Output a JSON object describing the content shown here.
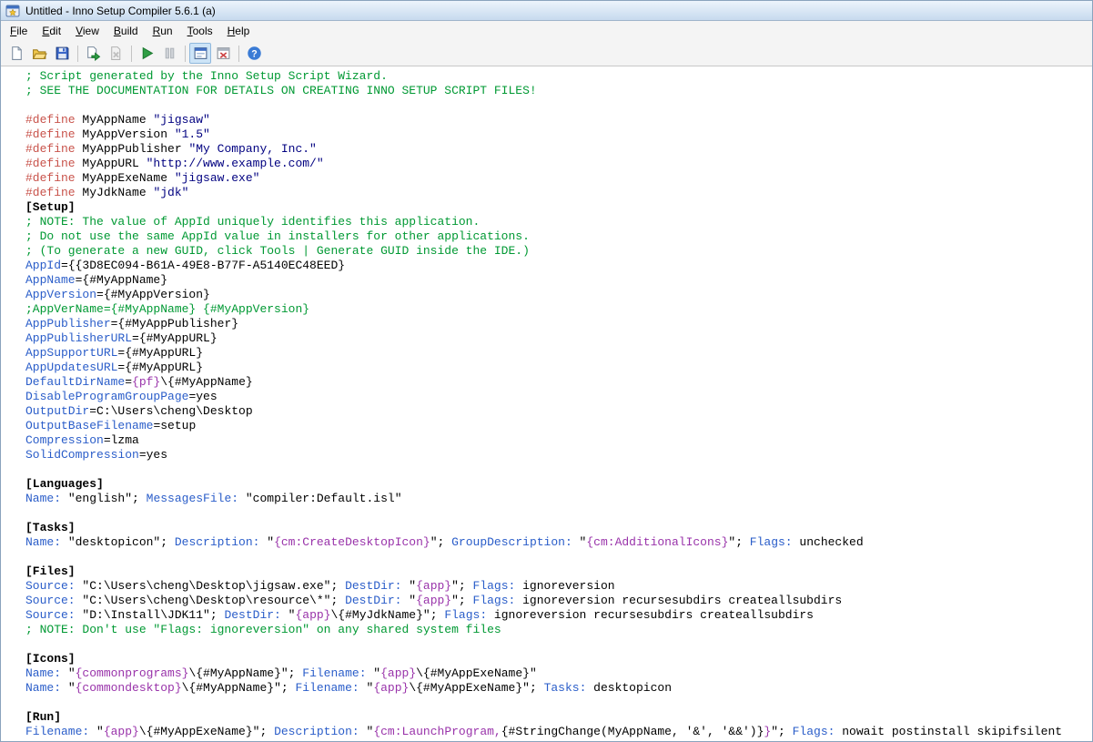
{
  "window": {
    "title": "Untitled - Inno Setup Compiler 5.6.1 (a)"
  },
  "menu": {
    "items": [
      "File",
      "Edit",
      "View",
      "Build",
      "Run",
      "Tools",
      "Help"
    ]
  },
  "toolbar": {
    "buttons": [
      {
        "name": "new-script",
        "icon": "new-script",
        "enabled": true
      },
      {
        "name": "open-script",
        "icon": "open-script",
        "enabled": true
      },
      {
        "name": "save-script",
        "icon": "save-script",
        "enabled": true
      },
      {
        "type": "separator"
      },
      {
        "name": "compile",
        "icon": "compile",
        "enabled": true
      },
      {
        "name": "stop-compile",
        "icon": "stop-compile",
        "enabled": false
      },
      {
        "type": "separator"
      },
      {
        "name": "run",
        "icon": "run",
        "enabled": true
      },
      {
        "name": "pause",
        "icon": "pause",
        "enabled": false
      },
      {
        "type": "separator"
      },
      {
        "name": "target-setup",
        "icon": "target-setup",
        "enabled": true,
        "pressed": true
      },
      {
        "name": "target-uninstall",
        "icon": "target-uninstall",
        "enabled": true
      },
      {
        "type": "separator"
      },
      {
        "name": "help",
        "icon": "help",
        "enabled": true
      }
    ]
  },
  "editor": {
    "syntax_colors": {
      "comment": "#009933",
      "define": "#C8524A",
      "keyword": "#2A5DC9",
      "constant": "#9933AA",
      "string": "#000080",
      "section": "#000000",
      "text": "#000000"
    },
    "lines": [
      [
        [
          "c",
          "; Script generated by the Inno Setup Script Wizard."
        ]
      ],
      [
        [
          "c",
          "; SEE THE DOCUMENTATION FOR DETAILS ON CREATING INNO SETUP SCRIPT FILES!"
        ]
      ],
      [],
      [
        [
          "d",
          "#define"
        ],
        [
          "t",
          " MyAppName "
        ],
        [
          "s",
          "\"jigsaw\""
        ]
      ],
      [
        [
          "d",
          "#define"
        ],
        [
          "t",
          " MyAppVersion "
        ],
        [
          "s",
          "\"1.5\""
        ]
      ],
      [
        [
          "d",
          "#define"
        ],
        [
          "t",
          " MyAppPublisher "
        ],
        [
          "s",
          "\"My Company, Inc.\""
        ]
      ],
      [
        [
          "d",
          "#define"
        ],
        [
          "t",
          " MyAppURL "
        ],
        [
          "s",
          "\"http://www.example.com/\""
        ]
      ],
      [
        [
          "d",
          "#define"
        ],
        [
          "t",
          " MyAppExeName "
        ],
        [
          "s",
          "\"jigsaw.exe\""
        ]
      ],
      [
        [
          "d",
          "#define"
        ],
        [
          "t",
          " MyJdkName "
        ],
        [
          "s",
          "\"jdk\""
        ]
      ],
      [
        [
          "b",
          "[Setup]"
        ]
      ],
      [
        [
          "c",
          "; NOTE: The value of AppId uniquely identifies this application."
        ]
      ],
      [
        [
          "c",
          "; Do not use the same AppId value in installers for other applications."
        ]
      ],
      [
        [
          "c",
          "; (To generate a new GUID, click Tools | Generate GUID inside the IDE.)"
        ]
      ],
      [
        [
          "k",
          "AppId"
        ],
        [
          "t",
          "={{3D8EC094-B61A-49E8-B77F-A5140EC48EED}"
        ]
      ],
      [
        [
          "k",
          "AppName"
        ],
        [
          "t",
          "={#MyAppName}"
        ]
      ],
      [
        [
          "k",
          "AppVersion"
        ],
        [
          "t",
          "={#MyAppVersion}"
        ]
      ],
      [
        [
          "c",
          ";AppVerName={#MyAppName} {#MyAppVersion}"
        ]
      ],
      [
        [
          "k",
          "AppPublisher"
        ],
        [
          "t",
          "={#MyAppPublisher}"
        ]
      ],
      [
        [
          "k",
          "AppPublisherURL"
        ],
        [
          "t",
          "={#MyAppURL}"
        ]
      ],
      [
        [
          "k",
          "AppSupportURL"
        ],
        [
          "t",
          "={#MyAppURL}"
        ]
      ],
      [
        [
          "k",
          "AppUpdatesURL"
        ],
        [
          "t",
          "={#MyAppURL}"
        ]
      ],
      [
        [
          "k",
          "DefaultDirName"
        ],
        [
          "t",
          "="
        ],
        [
          "p",
          "{pf}"
        ],
        [
          "t",
          "\\{#MyAppName}"
        ]
      ],
      [
        [
          "k",
          "DisableProgramGroupPage"
        ],
        [
          "t",
          "=yes"
        ]
      ],
      [
        [
          "k",
          "OutputDir"
        ],
        [
          "t",
          "=C:\\Users\\cheng\\Desktop"
        ]
      ],
      [
        [
          "k",
          "OutputBaseFilename"
        ],
        [
          "t",
          "=setup"
        ]
      ],
      [
        [
          "k",
          "Compression"
        ],
        [
          "t",
          "=lzma"
        ]
      ],
      [
        [
          "k",
          "SolidCompression"
        ],
        [
          "t",
          "=yes"
        ]
      ],
      [],
      [
        [
          "b",
          "[Languages]"
        ]
      ],
      [
        [
          "k",
          "Name:"
        ],
        [
          "t",
          " \"english\"; "
        ],
        [
          "k",
          "MessagesFile:"
        ],
        [
          "t",
          " \"compiler:Default.isl\""
        ]
      ],
      [],
      [
        [
          "b",
          "[Tasks]"
        ]
      ],
      [
        [
          "k",
          "Name:"
        ],
        [
          "t",
          " \"desktopicon\"; "
        ],
        [
          "k",
          "Description:"
        ],
        [
          "t",
          " \""
        ],
        [
          "p",
          "{cm:CreateDesktopIcon}"
        ],
        [
          "t",
          "\"; "
        ],
        [
          "k",
          "GroupDescription:"
        ],
        [
          "t",
          " \""
        ],
        [
          "p",
          "{cm:AdditionalIcons}"
        ],
        [
          "t",
          "\"; "
        ],
        [
          "k",
          "Flags:"
        ],
        [
          "t",
          " unchecked"
        ]
      ],
      [],
      [
        [
          "b",
          "[Files]"
        ]
      ],
      [
        [
          "k",
          "Source:"
        ],
        [
          "t",
          " \"C:\\Users\\cheng\\Desktop\\jigsaw.exe\"; "
        ],
        [
          "k",
          "DestDir:"
        ],
        [
          "t",
          " \""
        ],
        [
          "p",
          "{app}"
        ],
        [
          "t",
          "\"; "
        ],
        [
          "k",
          "Flags:"
        ],
        [
          "t",
          " ignoreversion"
        ]
      ],
      [
        [
          "k",
          "Source:"
        ],
        [
          "t",
          " \"C:\\Users\\cheng\\Desktop\\resource\\*\"; "
        ],
        [
          "k",
          "DestDir:"
        ],
        [
          "t",
          " \""
        ],
        [
          "p",
          "{app}"
        ],
        [
          "t",
          "\"; "
        ],
        [
          "k",
          "Flags:"
        ],
        [
          "t",
          " ignoreversion recursesubdirs createallsubdirs"
        ]
      ],
      [
        [
          "k",
          "Source:"
        ],
        [
          "t",
          " \"D:\\Install\\JDK11\"; "
        ],
        [
          "k",
          "DestDir:"
        ],
        [
          "t",
          " \""
        ],
        [
          "p",
          "{app}"
        ],
        [
          "t",
          "\\{#MyJdkName}\"; "
        ],
        [
          "k",
          "Flags:"
        ],
        [
          "t",
          " ignoreversion recursesubdirs createallsubdirs"
        ]
      ],
      [
        [
          "c",
          "; NOTE: Don't use \"Flags: ignoreversion\" on any shared system files"
        ]
      ],
      [],
      [
        [
          "b",
          "[Icons]"
        ]
      ],
      [
        [
          "k",
          "Name:"
        ],
        [
          "t",
          " \""
        ],
        [
          "p",
          "{commonprograms}"
        ],
        [
          "t",
          "\\{#MyAppName}\"; "
        ],
        [
          "k",
          "Filename:"
        ],
        [
          "t",
          " \""
        ],
        [
          "p",
          "{app}"
        ],
        [
          "t",
          "\\{#MyAppExeName}\""
        ]
      ],
      [
        [
          "k",
          "Name:"
        ],
        [
          "t",
          " \""
        ],
        [
          "p",
          "{commondesktop}"
        ],
        [
          "t",
          "\\{#MyAppName}\"; "
        ],
        [
          "k",
          "Filename:"
        ],
        [
          "t",
          " \""
        ],
        [
          "p",
          "{app}"
        ],
        [
          "t",
          "\\{#MyAppExeName}\"; "
        ],
        [
          "k",
          "Tasks:"
        ],
        [
          "t",
          " desktopicon"
        ]
      ],
      [],
      [
        [
          "b",
          "[Run]"
        ]
      ],
      [
        [
          "k",
          "Filename:"
        ],
        [
          "t",
          " \""
        ],
        [
          "p",
          "{app}"
        ],
        [
          "t",
          "\\{#MyAppExeName}\"; "
        ],
        [
          "k",
          "Description:"
        ],
        [
          "t",
          " \""
        ],
        [
          "p",
          "{cm:LaunchProgram,"
        ],
        [
          "t",
          "{#StringChange(MyAppName, '&', '&&')}"
        ],
        [
          "p",
          "}"
        ],
        [
          "t",
          "\"; "
        ],
        [
          "k",
          "Flags:"
        ],
        [
          "t",
          " nowait postinstall skipifsilent"
        ]
      ]
    ]
  }
}
